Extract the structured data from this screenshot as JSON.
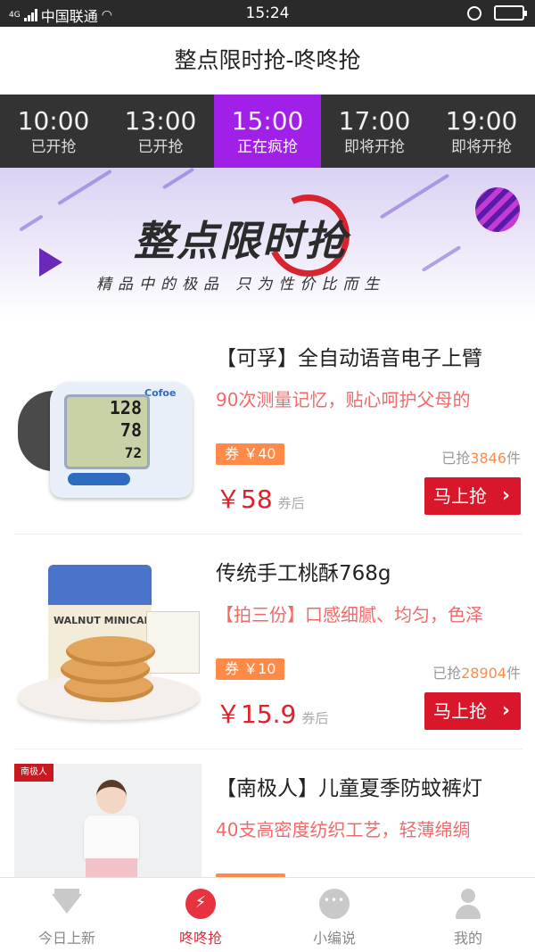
{
  "status_bar": {
    "network": "4G",
    "carrier": "中国联通",
    "time": "15:24"
  },
  "header": {
    "title": "整点限时抢-咚咚抢"
  },
  "tabs": [
    {
      "time": "10:00",
      "status": "已开抢",
      "active": false
    },
    {
      "time": "13:00",
      "status": "已开抢",
      "active": false
    },
    {
      "time": "15:00",
      "status": "正在疯抢",
      "active": true
    },
    {
      "time": "17:00",
      "status": "即将开抢",
      "active": false
    },
    {
      "time": "19:00",
      "status": "即将开抢",
      "active": false
    }
  ],
  "banner": {
    "title": "整点限时抢",
    "subtitle": "精品中的极品 只为性价比而生"
  },
  "products": [
    {
      "title": "【可孚】全自动语音电子上臂",
      "desc": "90次测量记忆，贴心呵护父母的",
      "coupon": "券 ￥40",
      "sold_prefix": "已抢",
      "sold_count": "3846",
      "sold_suffix": "件",
      "price": "￥58",
      "price_note": "券后",
      "buy_label": "马上抢",
      "image": {
        "brand": "Cofoe",
        "display": [
          "128",
          "78",
          "72"
        ]
      }
    },
    {
      "title": "传统手工桃酥768g",
      "desc": "【拍三份】口感细腻、均匀，色泽",
      "coupon": "券 ￥10",
      "sold_prefix": "已抢",
      "sold_count": "28904",
      "sold_suffix": "件",
      "price": "￥15.9",
      "price_note": "券后",
      "buy_label": "马上抢",
      "image": {
        "bag_label": "WALNUT MINICAKE"
      }
    },
    {
      "title": "【南极人】儿童夏季防蚊裤灯",
      "desc": "40支高密度纺织工艺，轻薄绵绸",
      "image": {
        "logo": "南极人"
      }
    }
  ],
  "bottom_nav": [
    {
      "label": "今日上新",
      "icon": "diamond-icon",
      "active": false
    },
    {
      "label": "咚咚抢",
      "icon": "flash-clock-icon",
      "active": true
    },
    {
      "label": "小编说",
      "icon": "chat-bubble-icon",
      "active": false
    },
    {
      "label": "我的",
      "icon": "user-icon",
      "active": false
    }
  ],
  "colors": {
    "accent": "#a120e8",
    "price_red": "#e0202a",
    "buy_button": "#d8182a",
    "coupon": "#ff8a48",
    "tab_bar": "#333333"
  }
}
